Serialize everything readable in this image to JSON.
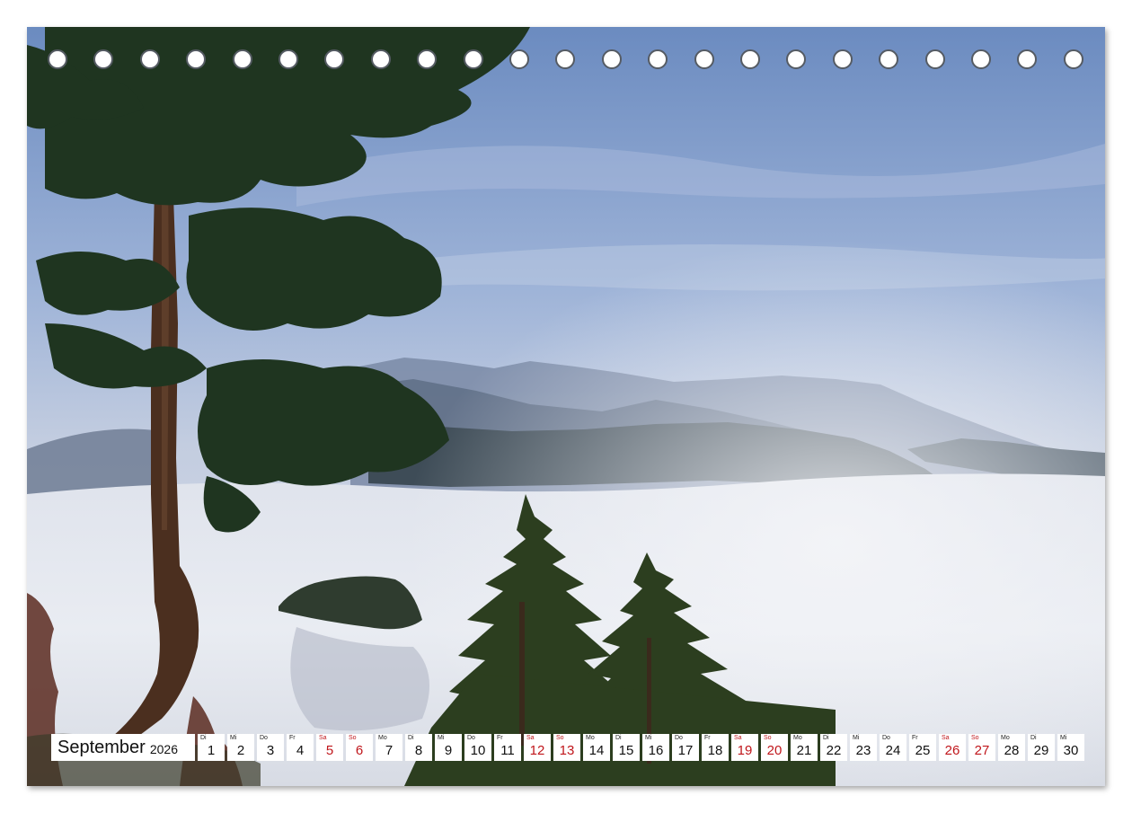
{
  "calendar": {
    "month_name": "September",
    "year": "2026",
    "days": [
      {
        "wd": "Di",
        "n": "1",
        "weekend": false
      },
      {
        "wd": "Mi",
        "n": "2",
        "weekend": false
      },
      {
        "wd": "Do",
        "n": "3",
        "weekend": false
      },
      {
        "wd": "Fr",
        "n": "4",
        "weekend": false
      },
      {
        "wd": "Sa",
        "n": "5",
        "weekend": true
      },
      {
        "wd": "So",
        "n": "6",
        "weekend": true
      },
      {
        "wd": "Mo",
        "n": "7",
        "weekend": false
      },
      {
        "wd": "Di",
        "n": "8",
        "weekend": false
      },
      {
        "wd": "Mi",
        "n": "9",
        "weekend": false
      },
      {
        "wd": "Do",
        "n": "10",
        "weekend": false
      },
      {
        "wd": "Fr",
        "n": "11",
        "weekend": false
      },
      {
        "wd": "Sa",
        "n": "12",
        "weekend": true
      },
      {
        "wd": "So",
        "n": "13",
        "weekend": true
      },
      {
        "wd": "Mo",
        "n": "14",
        "weekend": false
      },
      {
        "wd": "Di",
        "n": "15",
        "weekend": false
      },
      {
        "wd": "Mi",
        "n": "16",
        "weekend": false
      },
      {
        "wd": "Do",
        "n": "17",
        "weekend": false
      },
      {
        "wd": "Fr",
        "n": "18",
        "weekend": false
      },
      {
        "wd": "Sa",
        "n": "19",
        "weekend": true
      },
      {
        "wd": "So",
        "n": "20",
        "weekend": true
      },
      {
        "wd": "Mo",
        "n": "21",
        "weekend": false
      },
      {
        "wd": "Di",
        "n": "22",
        "weekend": false
      },
      {
        "wd": "Mi",
        "n": "23",
        "weekend": false
      },
      {
        "wd": "Do",
        "n": "24",
        "weekend": false
      },
      {
        "wd": "Fr",
        "n": "25",
        "weekend": false
      },
      {
        "wd": "Sa",
        "n": "26",
        "weekend": true
      },
      {
        "wd": "So",
        "n": "27",
        "weekend": true
      },
      {
        "wd": "Mo",
        "n": "28",
        "weekend": false
      },
      {
        "wd": "Di",
        "n": "29",
        "weekend": false
      },
      {
        "wd": "Mi",
        "n": "30",
        "weekend": false
      }
    ]
  },
  "colors": {
    "weekend": "#c0161b",
    "sky_top": "#6f8fc2",
    "fog": "#e6e9f0"
  },
  "binding": {
    "hole_count": 23
  }
}
